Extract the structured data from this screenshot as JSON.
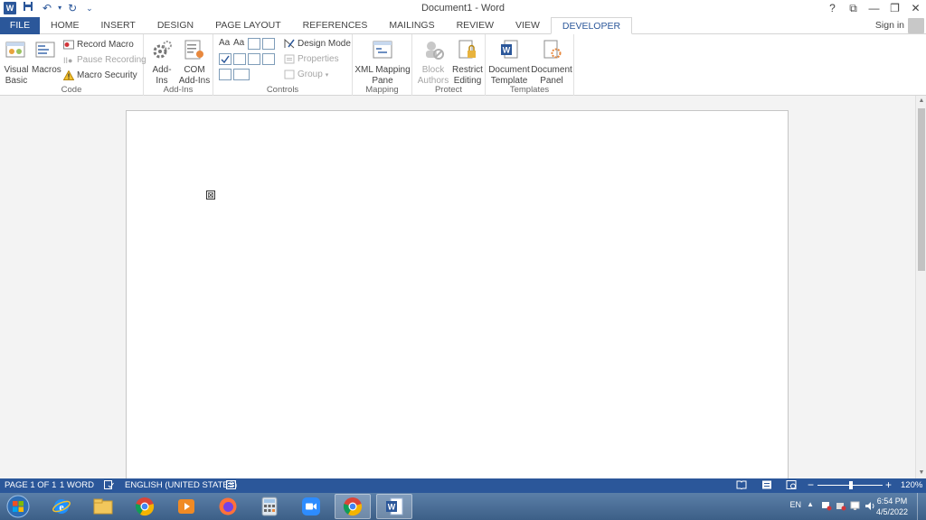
{
  "title_bar": {
    "title": "Document1 - Word",
    "help": "?",
    "restore_ribbon": "⧉",
    "minimize": "—",
    "maximize": "❐",
    "close": "✕"
  },
  "qat": {
    "save_icon": "save-icon",
    "undo": "↶",
    "undo_dd": "▾",
    "redo": "↻",
    "customize": "⌄"
  },
  "tabs": [
    "FILE",
    "HOME",
    "INSERT",
    "DESIGN",
    "PAGE LAYOUT",
    "REFERENCES",
    "MAILINGS",
    "REVIEW",
    "VIEW",
    "DEVELOPER"
  ],
  "active_tab": "DEVELOPER",
  "sign_in": "Sign in",
  "ribbon": {
    "code": {
      "label": "Code",
      "visual_basic": "Visual Basic",
      "macros": "Macros",
      "record_macro": "Record Macro",
      "pause_recording": "Pause Recording",
      "macro_security": "Macro Security"
    },
    "addins": {
      "label": "Add-Ins",
      "add_ins": "Add-Ins",
      "com_add_ins": "COM Add-Ins"
    },
    "controls": {
      "label": "Controls",
      "aa1": "Aa",
      "aa2": "Aa",
      "design_mode": "Design Mode",
      "properties": "Properties",
      "group": "Group"
    },
    "mapping": {
      "label": "Mapping",
      "xml_mapping_pane": "XML Mapping Pane"
    },
    "protect": {
      "label": "Protect",
      "block_authors": "Block Authors",
      "restrict_editing": "Restrict Editing"
    },
    "templates": {
      "label": "Templates",
      "document_template": "Document Template",
      "document_panel": "Document Panel"
    }
  },
  "document": {
    "checkbox_symbol": "⊠"
  },
  "status_bar": {
    "page": "PAGE 1 OF 1",
    "words": "1 WORD",
    "language": "ENGLISH (UNITED STATES)",
    "zoom_out": "−",
    "zoom_in": "+",
    "zoom": "120%"
  },
  "taskbar": {
    "lang": "EN",
    "time": "6:54 PM",
    "date": "4/5/2022",
    "apps": [
      "start",
      "internet-explorer",
      "file-explorer",
      "chrome",
      "media-player",
      "firefox",
      "calculator",
      "zoom",
      "chrome",
      "word"
    ]
  },
  "colors": {
    "word_blue": "#2b579a",
    "taskbar": "#3c5f87"
  }
}
